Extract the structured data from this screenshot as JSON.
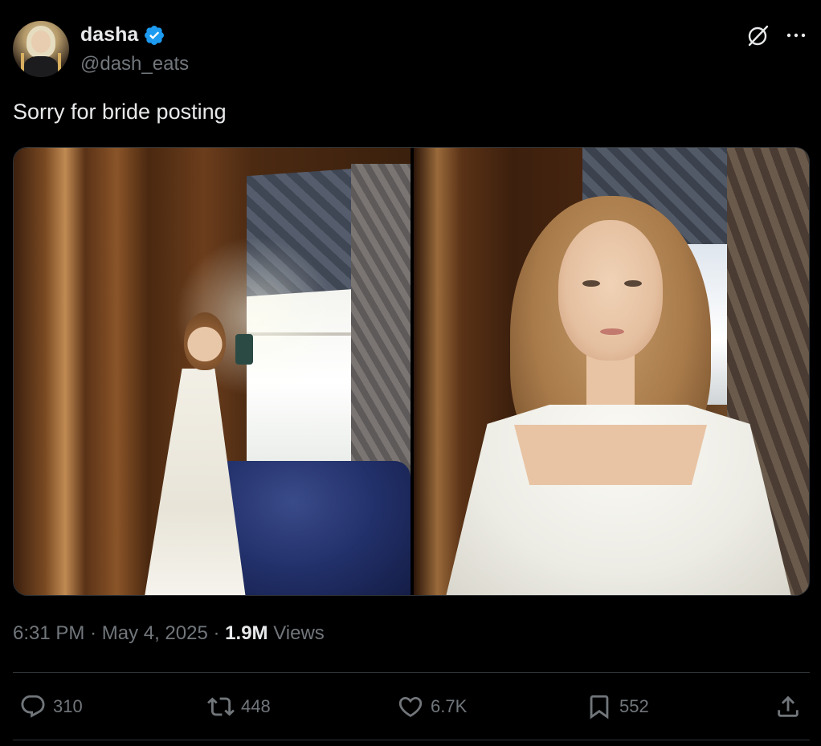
{
  "author": {
    "display_name": "dasha",
    "handle": "@dash_eats",
    "verified": true
  },
  "header_icons": [
    "grok-icon",
    "more-icon"
  ],
  "tweet": {
    "text": "Sorry for bride posting"
  },
  "media": {
    "count": 2
  },
  "meta": {
    "time": "6:31 PM",
    "separator": "·",
    "date": "May 4, 2025",
    "views_count": "1.9M",
    "views_label": "Views"
  },
  "actions": {
    "replies": "310",
    "reposts": "448",
    "likes": "6.7K",
    "bookmarks": "552"
  },
  "colors": {
    "background": "#000000",
    "text_primary": "#e7e9ea",
    "text_secondary": "#71767b",
    "divider": "#2f3336",
    "verified_blue": "#1d9bf0"
  }
}
